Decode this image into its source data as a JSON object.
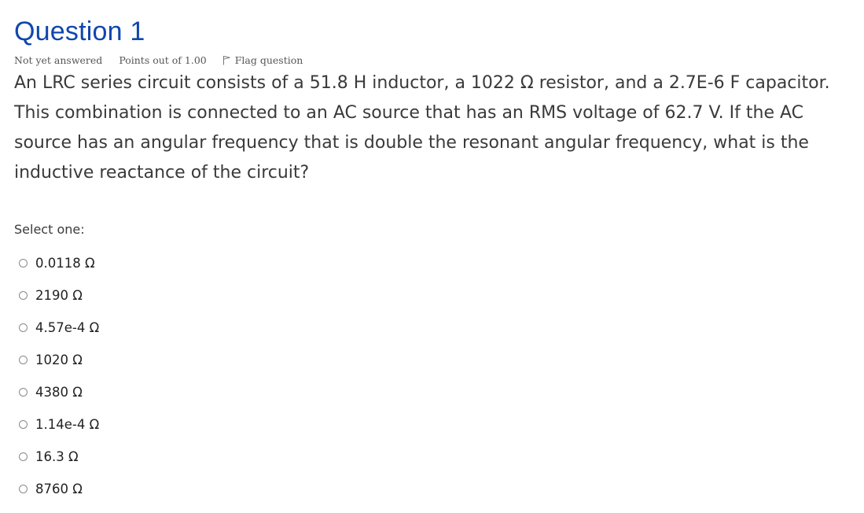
{
  "question": {
    "title": "Question 1",
    "state": "Not yet answered",
    "grade": "Points out of 1.00",
    "flag_label": "Flag question",
    "text": "An LRC series circuit consists of a 51.8 H inductor, a 1022 Ω resistor, and a 2.7E-6 F capacitor. This combination is connected to an AC source that has an RMS voltage of 62.7 V. If the AC source has an angular frequency that is double the resonant angular frequency, what is the inductive reactance of the circuit?",
    "prompt": "Select one:",
    "answers": [
      {
        "label": "0.0118 Ω"
      },
      {
        "label": "2190 Ω"
      },
      {
        "label": "4.57e-4 Ω"
      },
      {
        "label": "1020 Ω"
      },
      {
        "label": "4380 Ω"
      },
      {
        "label": "1.14e-4 Ω"
      },
      {
        "label": "16.3 Ω"
      },
      {
        "label": "8760 Ω"
      }
    ]
  },
  "icons": {
    "flag": "flag-icon",
    "radio": "radio-unselected"
  },
  "colors": {
    "title": "#0f47ad",
    "text": "#3a3a3a",
    "meta": "#555555",
    "radio_border": "#8a8a8a"
  }
}
